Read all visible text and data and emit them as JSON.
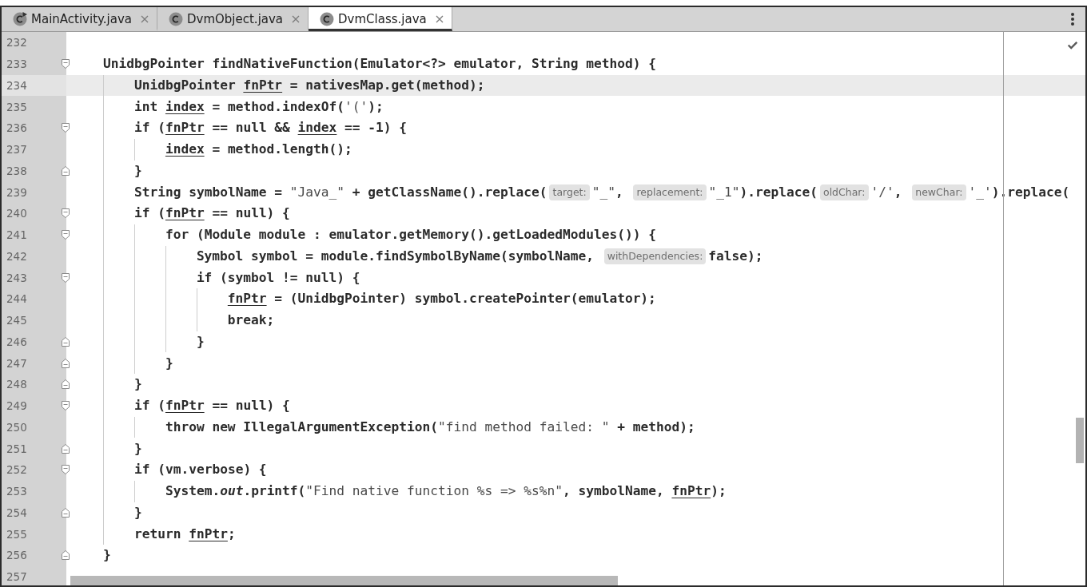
{
  "tabs": [
    {
      "label": "MainActivity.java",
      "kind": "runnable",
      "selected": false
    },
    {
      "label": "DvmObject.java",
      "kind": "class",
      "selected": false
    },
    {
      "label": "DvmClass.java",
      "kind": "class",
      "selected": true
    }
  ],
  "editor": {
    "lines": [
      {
        "number": "232",
        "current": false
      },
      {
        "number": "233",
        "fold": {
          "kind": "start"
        },
        "current": false,
        "segments": [
          {
            "text": "    UnidbgPointer findNativeFunction(Emulator<?> emulator, String method) {",
            "kind": "plain"
          }
        ]
      },
      {
        "number": "234",
        "current": true,
        "segments": [
          {
            "text": "        UnidbgPointer ",
            "kind": "plain"
          },
          {
            "text": "fnPtr",
            "kind": "reassigned"
          },
          {
            "text": " = nativesMap.get(method);",
            "kind": "plain"
          }
        ]
      },
      {
        "number": "235",
        "current": false,
        "segments": [
          {
            "text": "        int ",
            "kind": "plain"
          },
          {
            "text": "index",
            "kind": "reassigned"
          },
          {
            "text": " = method.indexOf(",
            "kind": "plain"
          },
          {
            "text": "'('",
            "kind": "string"
          },
          {
            "text": ");",
            "kind": "plain"
          }
        ]
      },
      {
        "number": "236",
        "fold": {
          "kind": "start"
        },
        "current": false,
        "segments": [
          {
            "text": "        if (",
            "kind": "plain"
          },
          {
            "text": "fnPtr",
            "kind": "reassigned"
          },
          {
            "text": " == null && ",
            "kind": "plain"
          },
          {
            "text": "index",
            "kind": "reassigned"
          },
          {
            "text": " == -1) {",
            "kind": "plain"
          }
        ]
      },
      {
        "number": "237",
        "current": false,
        "segments": [
          {
            "text": "            index",
            "kind": "reassigned"
          },
          {
            "text": " = method.length();",
            "kind": "plain"
          }
        ]
      },
      {
        "number": "238",
        "fold": {
          "kind": "end"
        },
        "current": false,
        "segments": [
          {
            "text": "        }",
            "kind": "plain"
          }
        ]
      },
      {
        "number": "239",
        "current": false,
        "segments": [
          {
            "text": "        String symbolName = ",
            "kind": "plain"
          },
          {
            "text": "\"Java_\"",
            "kind": "string"
          },
          {
            "text": " + getClassName().replace(",
            "kind": "plain"
          },
          {
            "text": "target:",
            "kind": "hint"
          },
          {
            "text": "\"_\"",
            "kind": "string"
          },
          {
            "text": ", ",
            "kind": "plain"
          },
          {
            "text": "replacement:",
            "kind": "hint"
          },
          {
            "text": "\"_1\"",
            "kind": "string"
          },
          {
            "text": ").replace(",
            "kind": "plain"
          },
          {
            "text": "oldChar:",
            "kind": "hint"
          },
          {
            "text": "'/'",
            "kind": "string"
          },
          {
            "text": ", ",
            "kind": "plain"
          },
          {
            "text": "newChar:",
            "kind": "hint"
          },
          {
            "text": "'_'",
            "kind": "string"
          },
          {
            "text": ").replace(",
            "kind": "plain"
          }
        ]
      },
      {
        "number": "240",
        "fold": {
          "kind": "start"
        },
        "current": false,
        "segments": [
          {
            "text": "        if (",
            "kind": "plain"
          },
          {
            "text": "fnPtr",
            "kind": "reassigned"
          },
          {
            "text": " == null) {",
            "kind": "plain"
          }
        ]
      },
      {
        "number": "241",
        "fold": {
          "kind": "start"
        },
        "current": false,
        "segments": [
          {
            "text": "            for (Module module : emulator.getMemory().getLoadedModules()) {",
            "kind": "plain"
          }
        ]
      },
      {
        "number": "242",
        "current": false,
        "segments": [
          {
            "text": "                Symbol symbol = module.findSymbolByName(symbolName, ",
            "kind": "plain"
          },
          {
            "text": "withDependencies:",
            "kind": "hint"
          },
          {
            "text": "false);",
            "kind": "plain"
          }
        ]
      },
      {
        "number": "243",
        "fold": {
          "kind": "start"
        },
        "current": false,
        "segments": [
          {
            "text": "                if (symbol != null) {",
            "kind": "plain"
          }
        ]
      },
      {
        "number": "244",
        "current": false,
        "segments": [
          {
            "text": "                    fnPtr",
            "kind": "reassigned"
          },
          {
            "text": " = (UnidbgPointer) symbol.createPointer(emulator);",
            "kind": "plain"
          }
        ]
      },
      {
        "number": "245",
        "current": false,
        "segments": [
          {
            "text": "                    break;",
            "kind": "plain"
          }
        ]
      },
      {
        "number": "246",
        "fold": {
          "kind": "end"
        },
        "current": false,
        "segments": [
          {
            "text": "                }",
            "kind": "plain"
          }
        ]
      },
      {
        "number": "247",
        "fold": {
          "kind": "end"
        },
        "current": false,
        "segments": [
          {
            "text": "            }",
            "kind": "plain"
          }
        ]
      },
      {
        "number": "248",
        "fold": {
          "kind": "end"
        },
        "current": false,
        "segments": [
          {
            "text": "        }",
            "kind": "plain"
          }
        ]
      },
      {
        "number": "249",
        "fold": {
          "kind": "start"
        },
        "current": false,
        "segments": [
          {
            "text": "        if (",
            "kind": "plain"
          },
          {
            "text": "fnPtr",
            "kind": "reassigned"
          },
          {
            "text": " == null) {",
            "kind": "plain"
          }
        ]
      },
      {
        "number": "250",
        "current": false,
        "segments": [
          {
            "text": "            throw new IllegalArgumentException(",
            "kind": "plain"
          },
          {
            "text": "\"find method failed: \"",
            "kind": "string"
          },
          {
            "text": " + method);",
            "kind": "plain"
          }
        ]
      },
      {
        "number": "251",
        "fold": {
          "kind": "end"
        },
        "current": false,
        "segments": [
          {
            "text": "        }",
            "kind": "plain"
          }
        ]
      },
      {
        "number": "252",
        "fold": {
          "kind": "start"
        },
        "current": false,
        "segments": [
          {
            "text": "        if (vm.verbose) {",
            "kind": "plain"
          }
        ]
      },
      {
        "number": "253",
        "current": false,
        "segments": [
          {
            "text": "            System.",
            "kind": "plain"
          },
          {
            "text": "out",
            "kind": "static"
          },
          {
            "text": ".printf(",
            "kind": "plain"
          },
          {
            "text": "\"Find native function %s => %s%n\"",
            "kind": "string"
          },
          {
            "text": ", symbolName, ",
            "kind": "plain"
          },
          {
            "text": "fnPtr",
            "kind": "reassigned"
          },
          {
            "text": ");",
            "kind": "plain"
          }
        ]
      },
      {
        "number": "254",
        "fold": {
          "kind": "end"
        },
        "current": false,
        "segments": [
          {
            "text": "        }",
            "kind": "plain"
          }
        ]
      },
      {
        "number": "255",
        "current": false,
        "segments": [
          {
            "text": "        return ",
            "kind": "plain"
          },
          {
            "text": "fnPtr",
            "kind": "reassigned"
          },
          {
            "text": ";",
            "kind": "plain"
          }
        ]
      },
      {
        "number": "256",
        "fold": {
          "kind": "end"
        },
        "current": false,
        "segments": [
          {
            "text": "    }",
            "kind": "plain"
          }
        ]
      },
      {
        "number": "257",
        "current": false
      }
    ]
  }
}
